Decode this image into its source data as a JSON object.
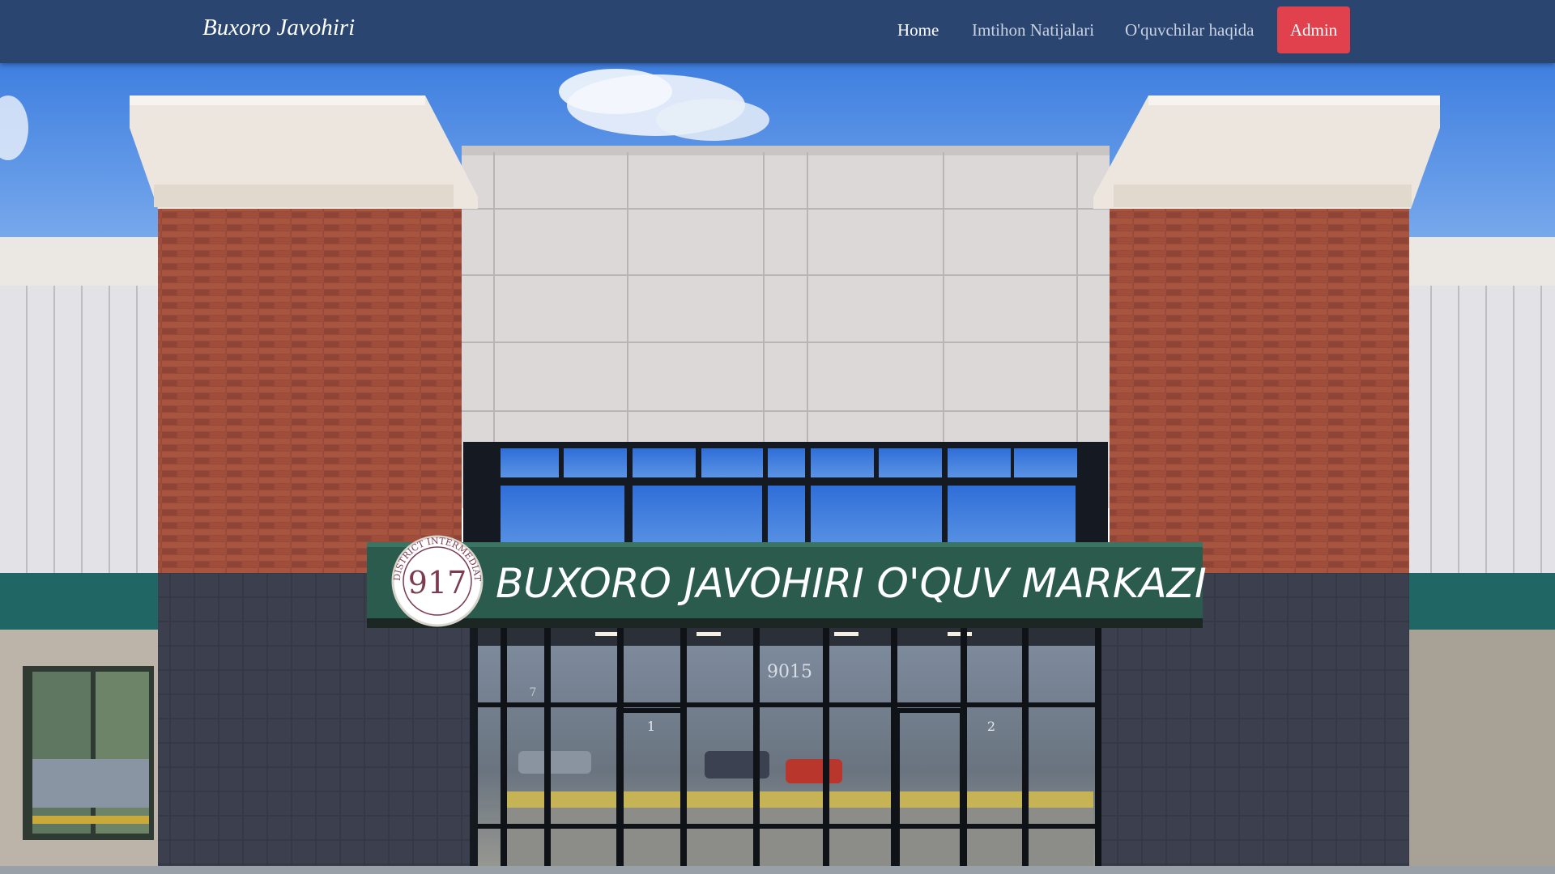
{
  "navbar": {
    "brand": "Buxoro Javohiri",
    "links": [
      {
        "label": "Home",
        "active": true
      },
      {
        "label": "Imtihon Natijalari",
        "active": false
      },
      {
        "label": "O'quvchilar haqida",
        "active": false
      }
    ],
    "admin_label": "Admin",
    "colors": {
      "background": "#2b4571",
      "admin": "#e0414c"
    }
  },
  "hero": {
    "sign_text": "BUXORO JAVOHIRI O'QUV MARKAZI",
    "seal_number": "917",
    "seal_ring_text": "DISTRICT INTERMEDIATE SCHOOL",
    "building_number": "9015",
    "door_numbers": [
      "1",
      "2",
      "7"
    ],
    "sign_color": "#2a5b4c"
  }
}
